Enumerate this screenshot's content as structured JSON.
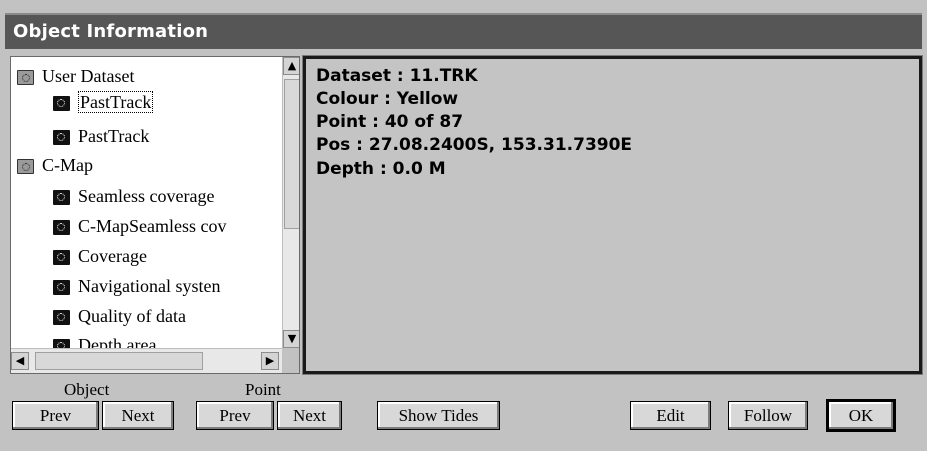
{
  "window": {
    "title": "Object Information"
  },
  "tree": {
    "items": [
      {
        "label": "User Dataset",
        "level": 0,
        "icon": "grey-folder-icon",
        "selected": false
      },
      {
        "label": "PastTrack",
        "level": 1,
        "icon": "open-folder-icon",
        "selected": true
      },
      {
        "label": "PastTrack",
        "level": 1,
        "icon": "folder-icon",
        "selected": false
      },
      {
        "label": "C-Map",
        "level": 0,
        "icon": "grey-folder-icon",
        "selected": false
      },
      {
        "label": "Seamless coverage",
        "level": 1,
        "icon": "folder-icon",
        "selected": false
      },
      {
        "label": "C-MapSeamless cov",
        "level": 1,
        "icon": "folder-icon",
        "selected": false
      },
      {
        "label": "Coverage",
        "level": 1,
        "icon": "folder-icon",
        "selected": false
      },
      {
        "label": "Navigational systen",
        "level": 1,
        "icon": "folder-icon",
        "selected": false
      },
      {
        "label": "Quality of data",
        "level": 1,
        "icon": "folder-icon",
        "selected": false
      },
      {
        "label": "Depth area",
        "level": 1,
        "icon": "folder-icon",
        "selected": false
      }
    ],
    "scroll_up": "▲",
    "scroll_down": "▼",
    "scroll_left": "◀",
    "scroll_right": "▶"
  },
  "info": {
    "lines": [
      "Dataset : 11.TRK",
      "Colour : Yellow",
      "Point : 40 of 87",
      "Pos :  27.08.2400S, 153.31.7390E",
      "Depth : 0.0 M"
    ]
  },
  "footer": {
    "object_label": "Object",
    "point_label": "Point",
    "object_prev": "Prev",
    "object_next": "Next",
    "point_prev": "Prev",
    "point_next": "Next",
    "show_tides": "Show Tides",
    "edit": "Edit",
    "follow": "Follow",
    "ok": "OK"
  }
}
